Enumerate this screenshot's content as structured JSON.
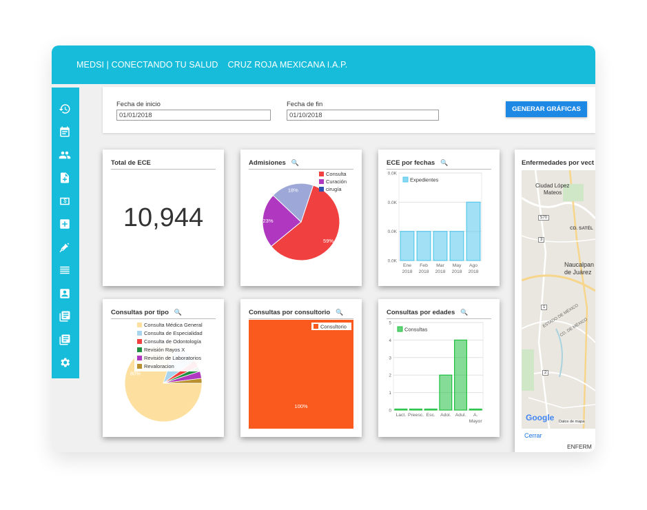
{
  "header": {
    "app_name": "MEDSI | CONECTANDO TU SALUD",
    "org_name": "CRUZ ROJA MEXICANA I.A.P."
  },
  "sidebar": {
    "icons": [
      "history-icon",
      "calendar-icon",
      "users-icon",
      "file-add-icon",
      "money-icon",
      "medical-cross-icon",
      "syringe-icon",
      "list-icon",
      "contact-card-icon",
      "library-books-icon",
      "library-books-icon-2",
      "gear-icon"
    ]
  },
  "filters": {
    "start_label": "Fecha de inicio",
    "start_value": "01/01/2018",
    "end_label": "Fecha de fin",
    "end_value": "01/10/2018",
    "generate_label": "GENERAR GRÁFICAS"
  },
  "cards": {
    "total": {
      "title": "Total de ECE",
      "value": "10,944"
    },
    "admisiones": {
      "title": "Admisiones"
    },
    "ece_fechas": {
      "title": "ECE por fechas"
    },
    "consultas_tipo": {
      "title": "Consultas por tipo"
    },
    "consultas_consultorio": {
      "title": "Consultas por consultorio"
    },
    "consultas_edades": {
      "title": "Consultas por edades"
    },
    "mapa": {
      "title": "Enfermedades por vect",
      "places": [
        "Ciudad López",
        "Mateos",
        "Naucalpan",
        "de Juárez",
        "CD. SATÉL",
        "ESTADO DE MÉXICO",
        "CD. DE MÉXICO",
        "570",
        "3",
        "1",
        "2"
      ],
      "google": "Google",
      "datos": "Datos de mapa",
      "close": "Cerrar",
      "footer": "ENFERM"
    }
  },
  "chart_data": [
    {
      "type": "pie",
      "title": "Admisiones",
      "labels": [
        "Consulta",
        "Curación",
        "cirugía"
      ],
      "values": [
        59,
        23,
        18
      ],
      "data_labels": [
        "59%",
        "23%",
        "18%"
      ],
      "colors": [
        "#f04040",
        "#b038c0",
        "#9da8d8"
      ],
      "legend_colors": [
        "#f04040",
        "#b038c0",
        "#3050b0"
      ]
    },
    {
      "type": "bar",
      "title": "ECE por fechas",
      "series": [
        {
          "name": "Expedientes",
          "values": [
            1,
            1,
            1,
            1,
            2
          ]
        }
      ],
      "categories": [
        [
          "Ene",
          "2018"
        ],
        [
          "Feb",
          "2018"
        ],
        [
          "Mar",
          "2018"
        ],
        [
          "May",
          "2018"
        ],
        [
          "Ago",
          "2018"
        ]
      ],
      "y_ticks": [
        "0.0K",
        "0.0K",
        "0.0K",
        "0.0K"
      ],
      "ylim": [
        0,
        3
      ],
      "color": "#56c8ec"
    },
    {
      "type": "pie",
      "title": "Consultas por tipo",
      "labels": [
        "Consulta Médica General",
        "Consulta de Especialidad",
        "Consulta de Odontología",
        "Revisión Rayos X",
        "Revisión de Laboratorios",
        "Revaloracion"
      ],
      "values": [
        80,
        10,
        3,
        2,
        3,
        2
      ],
      "data_labels": [
        "80%"
      ],
      "colors": [
        "#fde0a0",
        "#a8d4ee",
        "#f04040",
        "#209040",
        "#b038c0",
        "#b89030"
      ]
    },
    {
      "type": "pie",
      "title": "Consultas por consultorio",
      "labels": [
        "Consultorio"
      ],
      "values": [
        100
      ],
      "data_labels": [
        "100%"
      ],
      "colors": [
        "#fb5a1f"
      ]
    },
    {
      "type": "bar",
      "title": "Consultas por edades",
      "series": [
        {
          "name": "Consultas",
          "values": [
            0,
            0,
            0,
            2,
            4,
            0
          ]
        }
      ],
      "categories": [
        [
          "Lact."
        ],
        [
          "Preesc."
        ],
        [
          "Esc."
        ],
        [
          "Adol."
        ],
        [
          "Adul."
        ],
        [
          "A.",
          "Mayor"
        ]
      ],
      "y_ticks": [
        "0",
        "1",
        "2",
        "3",
        "4",
        "5"
      ],
      "ylim": [
        0,
        5
      ],
      "color": "#20c040"
    }
  ]
}
